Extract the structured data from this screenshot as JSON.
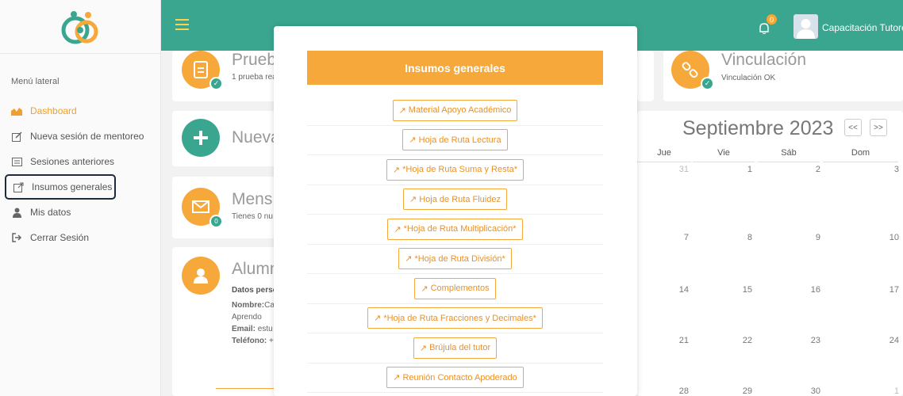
{
  "topbar": {
    "user_name": "Capacitación Tutores",
    "notifications_count": "0"
  },
  "sidebar": {
    "title": "Menú lateral",
    "items": [
      {
        "label": "Dashboard",
        "icon": "area-chart-icon"
      },
      {
        "label": "Nueva sesión de mentoreo",
        "icon": "edit-icon"
      },
      {
        "label": "Sesiones anteriores",
        "icon": "list-icon"
      },
      {
        "label": "Insumos generales",
        "icon": "external-link-icon"
      },
      {
        "label": "Mis datos",
        "icon": "user-icon"
      },
      {
        "label": "Cerrar Sesión",
        "icon": "sign-out-icon"
      }
    ]
  },
  "cards": {
    "prueba_title": "Prueb",
    "prueba_sub": "1 prueba rea",
    "nueva_title": "Nueva",
    "mensajes_title": "Mens",
    "mensajes_sub": "Tienes 0 nu",
    "mensajes_count": "0",
    "alumno_title": "Alumn",
    "alumno_datos": "Datos perso",
    "alumno_nombre_label": "Nombre:",
    "alumno_nombre_value": "Ca",
    "alumno_aprendo": "Aprendo",
    "alumno_email_label": "Email:",
    "alumno_email_value": "estu",
    "alumno_tel_label": "Teléfono:",
    "alumno_tel_value": "+",
    "vinculacion_title": "Vinculación",
    "vinculacion_sub": "Vinculación OK"
  },
  "calendar": {
    "title": "Septiembre 2023",
    "prev": "<<",
    "next": ">>",
    "days": [
      "Jue",
      "Vie",
      "Sáb",
      "Dom"
    ],
    "rows": [
      [
        "31",
        "1",
        "2",
        "3"
      ],
      [
        "7",
        "8",
        "9",
        "10"
      ],
      [
        "14",
        "15",
        "16",
        "17"
      ],
      [
        "21",
        "22",
        "23",
        "24"
      ],
      [
        "28",
        "29",
        "30",
        "1"
      ]
    ]
  },
  "modal": {
    "title": "Insumos generales",
    "links": [
      "Material Apoyo Académico",
      "Hoja de Ruta Lectura",
      "*Hoja de Ruta Suma y Resta*",
      "Hoja de Ruta Fluidez",
      "*Hoja de Ruta Multiplicación*",
      "*Hoja de Ruta División*",
      "Complementos",
      "*Hoja de Ruta Fracciones y Decimales*",
      "Brújula del tutor",
      "Reunión Contacto Apoderado"
    ]
  }
}
